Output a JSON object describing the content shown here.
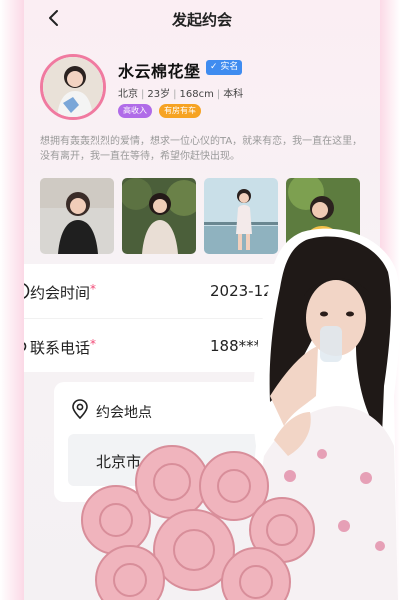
{
  "header": {
    "title": "发起约会"
  },
  "profile": {
    "name": "水云棉花堡",
    "verified": "实名",
    "city": "北京",
    "age": "23岁",
    "height": "168cm",
    "education": "本科",
    "tags": [
      "高收入",
      "有房有车"
    ],
    "bio": "想拥有轰轰烈烈的爱情，想求一位心仪的TA，就来有恋，我一直在这里，没有离开，我一直在等待，希望你赶快出现。"
  },
  "form": {
    "date_label": "约会时间",
    "date_value": "2023-12-01",
    "phone_label": "联系电话",
    "phone_value": "188****3",
    "required_mark": "*",
    "location_label": "约会地点",
    "location_value": "北京市 安街"
  },
  "colors": {
    "accent_pink": "#f24c78",
    "verify_blue": "#3f8cf0",
    "tag_purple": "#b06be8",
    "tag_orange": "#f6a323"
  },
  "icons": [
    "back-arrow-icon",
    "calendar-icon",
    "phone-icon",
    "location-pin-icon",
    "verified-icon"
  ]
}
